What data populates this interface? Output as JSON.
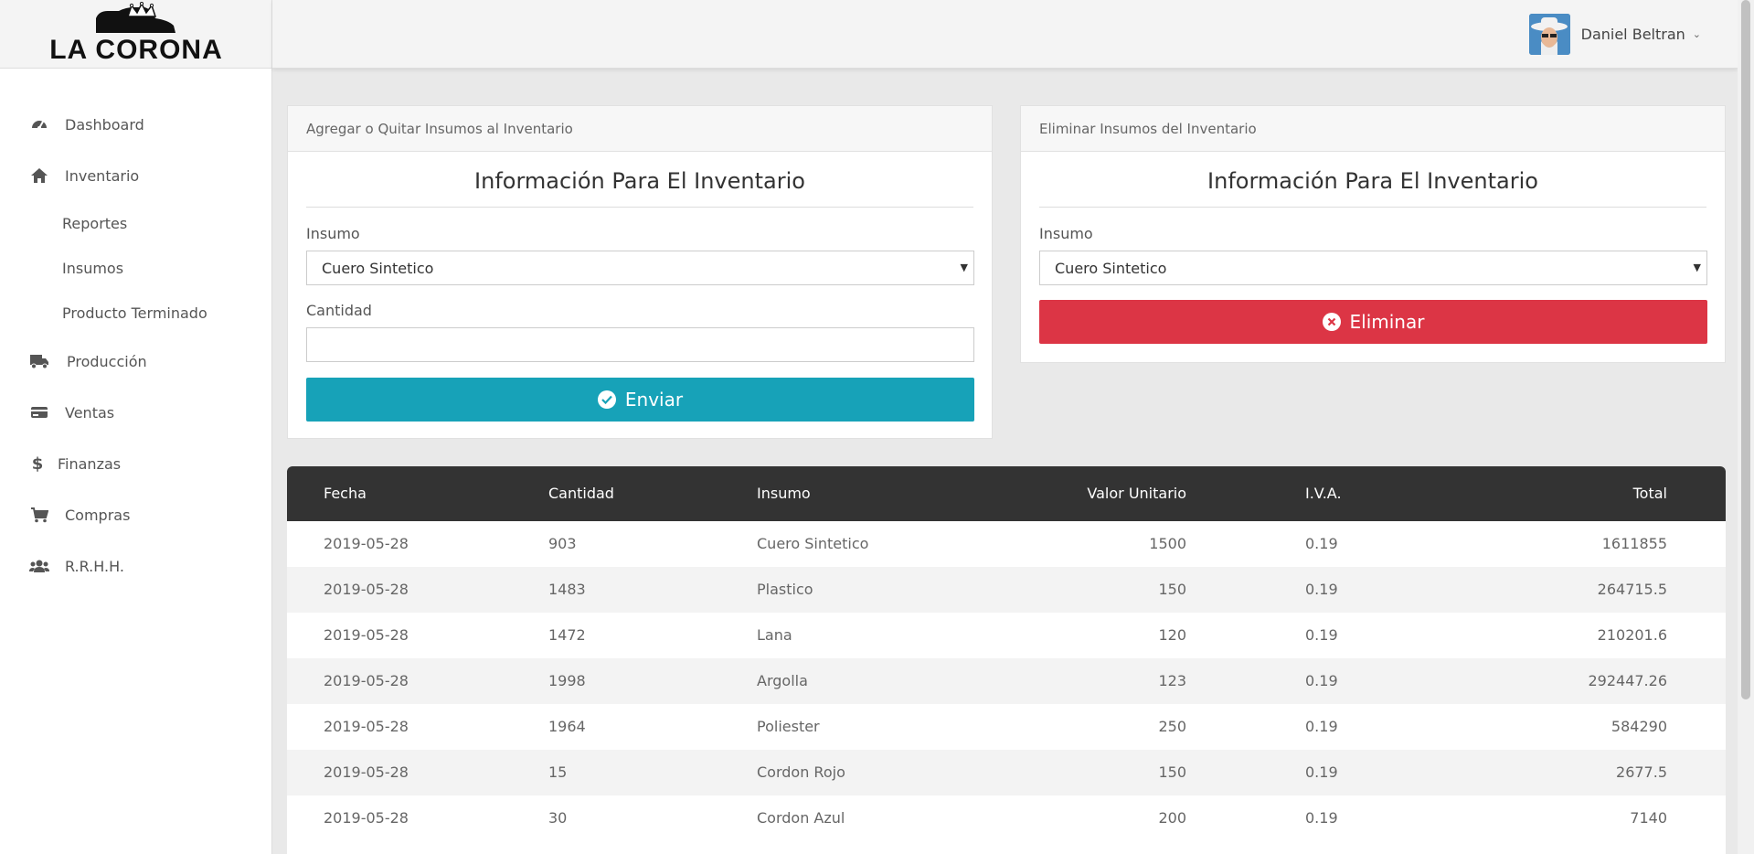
{
  "brand": {
    "name": "LA CORONA"
  },
  "user": {
    "name": "Daniel Beltran"
  },
  "sidebar": {
    "items": [
      {
        "label": "Dashboard",
        "icon": "dashboard-icon"
      },
      {
        "label": "Inventario",
        "icon": "home-icon"
      },
      {
        "label": "Reportes"
      },
      {
        "label": "Insumos"
      },
      {
        "label": "Producto Terminado"
      },
      {
        "label": "Producción",
        "icon": "truck-icon"
      },
      {
        "label": "Ventas",
        "icon": "credit-card-icon"
      },
      {
        "label": "Finanzas",
        "icon": "dollar-icon"
      },
      {
        "label": "Compras",
        "icon": "cart-icon"
      },
      {
        "label": "R.R.H.H.",
        "icon": "users-icon"
      }
    ]
  },
  "add_card": {
    "header": "Agregar o Quitar Insumos al Inventario",
    "title": "Información Para El Inventario",
    "insumo_label": "Insumo",
    "insumo_value": "Cuero Sintetico",
    "cantidad_label": "Cantidad",
    "cantidad_value": "",
    "submit_label": "Enviar",
    "submit_color": "#17a2b8"
  },
  "delete_card": {
    "header": "Eliminar Insumos del Inventario",
    "title": "Información Para El Inventario",
    "insumo_label": "Insumo",
    "insumo_value": "Cuero Sintetico",
    "delete_label": "Eliminar",
    "delete_color": "#dc3545"
  },
  "table": {
    "headers": [
      "Fecha",
      "Cantidad",
      "Insumo",
      "Valor Unitario",
      "I.V.A.",
      "Total"
    ],
    "rows": [
      [
        "2019-05-28",
        "903",
        "Cuero Sintetico",
        "1500",
        "0.19",
        "1611855"
      ],
      [
        "2019-05-28",
        "1483",
        "Plastico",
        "150",
        "0.19",
        "264715.5"
      ],
      [
        "2019-05-28",
        "1472",
        "Lana",
        "120",
        "0.19",
        "210201.6"
      ],
      [
        "2019-05-28",
        "1998",
        "Argolla",
        "123",
        "0.19",
        "292447.26"
      ],
      [
        "2019-05-28",
        "1964",
        "Poliester",
        "250",
        "0.19",
        "584290"
      ],
      [
        "2019-05-28",
        "15",
        "Cordon Rojo",
        "150",
        "0.19",
        "2677.5"
      ],
      [
        "2019-05-28",
        "30",
        "Cordon Azul",
        "200",
        "0.19",
        "7140"
      ]
    ]
  }
}
